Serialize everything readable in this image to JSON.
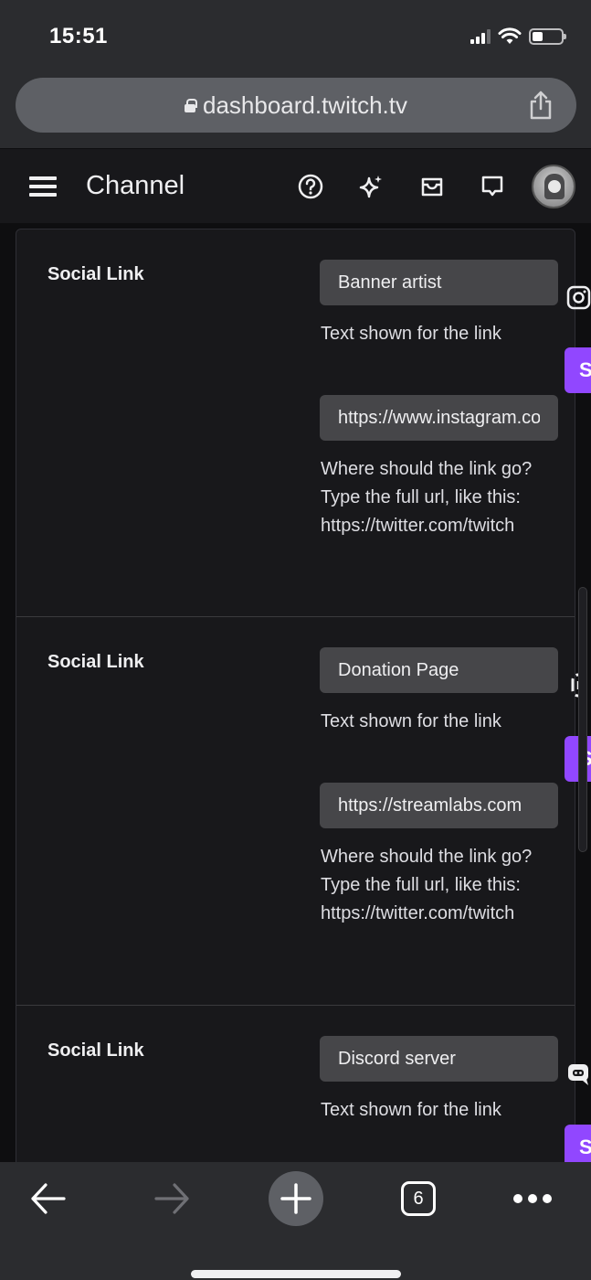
{
  "status_bar": {
    "time": "15:51",
    "signal_bars": 3,
    "battery_level_percent": 35
  },
  "browser": {
    "url": "dashboard.twitch.tv",
    "secure_icon": "lock-icon",
    "share_icon": "share-icon",
    "toolbar": {
      "back_icon": "arrow-left-icon",
      "forward_icon": "arrow-right-icon",
      "new_tab_icon": "plus-icon",
      "tab_count": "6",
      "more_icon": "ellipsis-icon"
    }
  },
  "header": {
    "menu_icon": "hamburger-icon",
    "title": "Channel",
    "icons": [
      "help-icon",
      "sparkle-icon",
      "inbox-icon",
      "whispers-icon"
    ],
    "avatar": "user-avatar"
  },
  "social_links": [
    {
      "label": "Social Link",
      "title_value": "Banner artist",
      "title_help": "Text shown for the link",
      "url_value": "https://www.instagram.com",
      "url_help": "Where should the link go? Type the full url, like this: https://twitter.com/twitch",
      "preview_icon": "instagram-icon",
      "preview_button": "S"
    },
    {
      "label": "Social Link",
      "title_value": "Donation Page",
      "title_help": "Text shown for the link",
      "url_value": "https://streamlabs.com",
      "url_help": "Where should the link go? Type the full url, like this: https://twitter.com/twitch",
      "preview_icon": "link-icon",
      "preview_button": "S"
    },
    {
      "label": "Social Link",
      "title_value": "Discord server",
      "title_help": "Text shown for the link",
      "preview_icon": "discord-icon",
      "preview_button": "S"
    }
  ],
  "colors": {
    "accent": "#9147ff",
    "background": "#0e0e10",
    "card": "#18181b",
    "input": "#464649"
  }
}
